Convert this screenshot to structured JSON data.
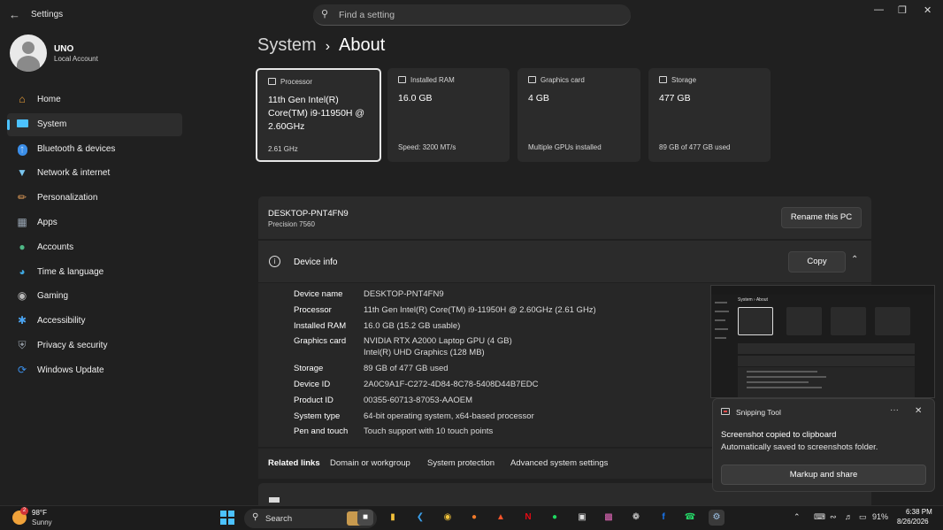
{
  "window": {
    "title": "Settings",
    "search_placeholder": "Find a setting"
  },
  "user": {
    "name": "UNO",
    "account_type": "Local Account"
  },
  "sidebar": {
    "items": [
      {
        "label": "Home",
        "icon": "home-icon",
        "color": "#f2a33a"
      },
      {
        "label": "System",
        "icon": "system-icon",
        "color": "#4cc2ff",
        "active": true
      },
      {
        "label": "Bluetooth & devices",
        "icon": "bluetooth-icon",
        "color": "#3b8ee8"
      },
      {
        "label": "Network & internet",
        "icon": "wifi-icon",
        "color": "#7ac6f0"
      },
      {
        "label": "Personalization",
        "icon": "brush-icon",
        "color": "#e8a15a"
      },
      {
        "label": "Apps",
        "icon": "apps-icon",
        "color": "#9aa7b5"
      },
      {
        "label": "Accounts",
        "icon": "accounts-icon",
        "color": "#4fb886"
      },
      {
        "label": "Time & language",
        "icon": "globe-clock-icon",
        "color": "#3fa7e0"
      },
      {
        "label": "Gaming",
        "icon": "gamepad-icon",
        "color": "#b9b9b9"
      },
      {
        "label": "Accessibility",
        "icon": "accessibility-icon",
        "color": "#4aa3f0"
      },
      {
        "label": "Privacy & security",
        "icon": "shield-icon",
        "color": "#9aa3ad"
      },
      {
        "label": "Windows Update",
        "icon": "update-icon",
        "color": "#3b8ee8"
      }
    ]
  },
  "breadcrumb": {
    "parent": "System",
    "separator": "›",
    "current": "About"
  },
  "cards": [
    {
      "label": "Processor",
      "value": "11th Gen Intel(R) Core(TM) i9-11950H @ 2.60GHz",
      "sub": "2.61 GHz",
      "selected": true
    },
    {
      "label": "Installed RAM",
      "value": "16.0 GB",
      "sub": "Speed: 3200 MT/s"
    },
    {
      "label": "Graphics card",
      "value": "4 GB",
      "sub": "Multiple GPUs installed"
    },
    {
      "label": "Storage",
      "value": "477 GB",
      "sub": "89 GB of 477 GB used"
    }
  ],
  "device": {
    "name": "DESKTOP-PNT4FN9",
    "model": "Precision 7560",
    "rename_label": "Rename this PC"
  },
  "device_info": {
    "title": "Device info",
    "copy_label": "Copy",
    "specs": [
      {
        "key": "Device name",
        "value": "DESKTOP-PNT4FN9"
      },
      {
        "key": "Processor",
        "value": "11th Gen Intel(R) Core(TM) i9-11950H @ 2.60GHz (2.61 GHz)"
      },
      {
        "key": "Installed RAM",
        "value": "16.0 GB (15.2 GB usable)"
      },
      {
        "key": "Graphics card",
        "value": "NVIDIA RTX A2000 Laptop GPU (4 GB)",
        "value2": "Intel(R) UHD Graphics (128 MB)"
      },
      {
        "key": "Storage",
        "value": "89 GB of 477 GB used"
      },
      {
        "key": "Device ID",
        "value": "2A0C9A1F-C272-4D84-8C78-5408D44B7EDC"
      },
      {
        "key": "Product ID",
        "value": "00355-60713-87053-AAOEM"
      },
      {
        "key": "System type",
        "value": "64-bit operating system, x64-based processor"
      },
      {
        "key": "Pen and touch",
        "value": "Touch support with 10 touch points"
      }
    ]
  },
  "related_links": {
    "title": "Related links",
    "links": [
      "Domain or workgroup",
      "System protection",
      "Advanced system settings"
    ]
  },
  "snip": {
    "thumb_breadcrumb": "System  ›  About",
    "app": "Snipping Tool",
    "more": "···",
    "title": "Screenshot copied to clipboard",
    "body": "Automatically saved to screenshots folder.",
    "button": "Markup and share"
  },
  "taskbar": {
    "weather_temp": "98°F",
    "weather_desc": "Sunny",
    "weather_badge": "2",
    "search_label": "Search",
    "battery": "91%",
    "time": "6:38 PM",
    "date": "8/26/2026"
  },
  "colors": {
    "accent": "#4cc2ff",
    "background": "#202020",
    "card": "#2b2b2b"
  }
}
